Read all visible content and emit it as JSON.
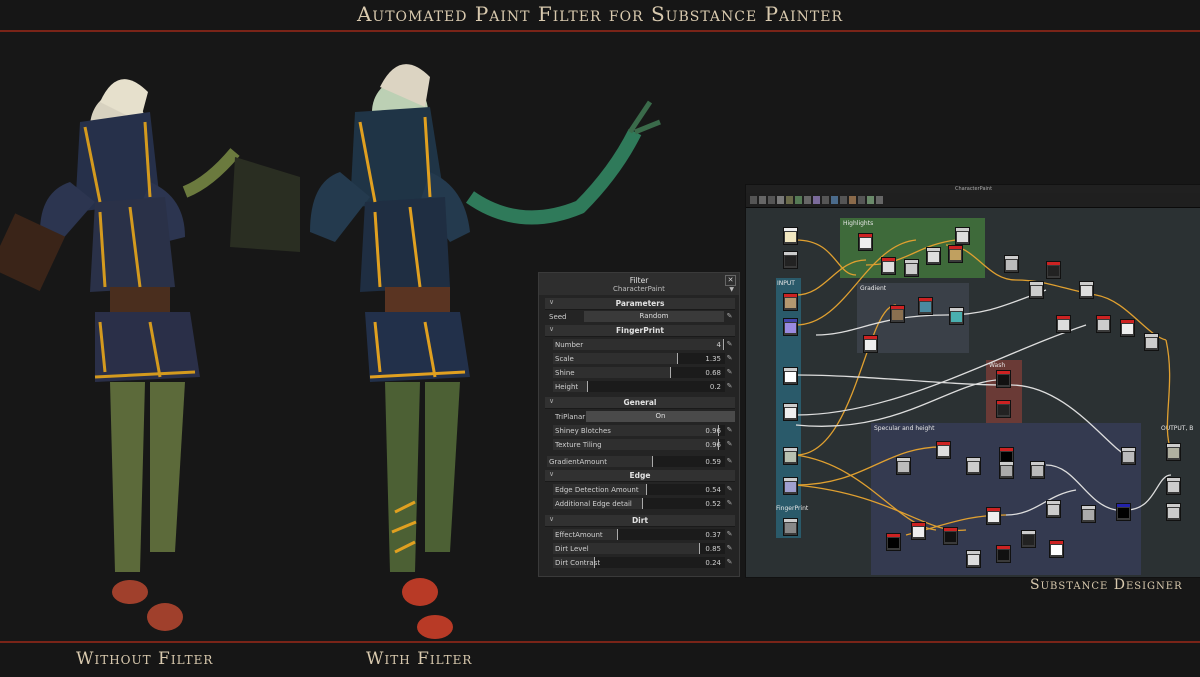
{
  "header": {
    "title": "Automated Paint Filter for Substance Painter"
  },
  "captions": {
    "without": "Without Filter",
    "with": "With Filter",
    "designer": "Substance Designer"
  },
  "colors": {
    "accent_red": "#7a2418",
    "caption": "#d8c9ae",
    "slider_marker": "#aaaaaa"
  },
  "panel": {
    "title": "Filter",
    "preset": "CharacterPaint",
    "close_icon": "close-icon",
    "sections": {
      "parameters": "Parameters",
      "fingerprint": "FingerPrint",
      "general": "General",
      "edge": "Edge",
      "dirt": "Dirt"
    },
    "seed": {
      "label": "Seed",
      "button": "Random"
    },
    "fingerprint": [
      {
        "label": "Number",
        "value": "4",
        "fraction": 0.99
      },
      {
        "label": "Scale",
        "value": "1.35",
        "fraction": 0.72
      },
      {
        "label": "Shine",
        "value": "0.68",
        "fraction": 0.68
      },
      {
        "label": "Height",
        "value": "0.2",
        "fraction": 0.2
      }
    ],
    "general": {
      "triplanar": {
        "label": "TriPlanar",
        "value": "On"
      },
      "sliders": [
        {
          "label": "Shiney Blotches",
          "value": "0.96",
          "fraction": 0.96
        },
        {
          "label": "Texture Tiling",
          "value": "0.96",
          "fraction": 0.96
        }
      ],
      "gradient": {
        "label": "GradientAmount",
        "value": "0.59",
        "fraction": 0.59
      }
    },
    "edge": [
      {
        "label": "Edge Detection Amount",
        "value": "0.54",
        "fraction": 0.54
      },
      {
        "label": "Additional Edge detail",
        "value": "0.52",
        "fraction": 0.52
      }
    ],
    "dirt": [
      {
        "label": "EffectAmount",
        "value": "0.37",
        "fraction": 0.37
      },
      {
        "label": "Dirt Level",
        "value": "0.85",
        "fraction": 0.85
      },
      {
        "label": "Dirt Contrast",
        "value": "0.24",
        "fraction": 0.24
      }
    ]
  },
  "designer": {
    "window_title": "CharacterPaint",
    "frames": {
      "highlights": "Highlights",
      "input": "INPUT",
      "gradient": "Gradient",
      "wash": "Wash",
      "specular": "Specular and height",
      "output": "OUTPUT, B",
      "fingerprint": "FingerPrint"
    }
  }
}
